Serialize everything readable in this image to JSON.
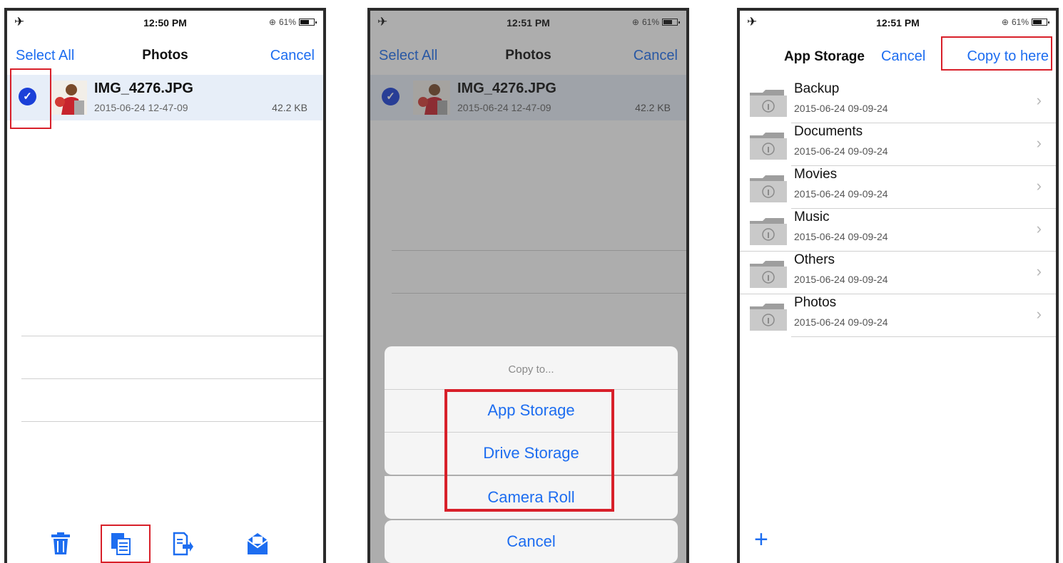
{
  "colors": {
    "accent": "#1d6df0",
    "highlight": "#d8202a",
    "selected_row": "#e7eef8"
  },
  "screen1": {
    "status": {
      "time": "12:50 PM",
      "battery": "61%"
    },
    "nav": {
      "left": "Select All",
      "title": "Photos",
      "right": "Cancel"
    },
    "file": {
      "name": "IMG_4276.JPG",
      "date": "2015-06-24 12-47-09",
      "size": "42.2 KB"
    },
    "toolbar_icons": [
      "trash-icon",
      "copy-icon",
      "export-icon",
      "mail-icon"
    ]
  },
  "screen2": {
    "status": {
      "time": "12:51 PM",
      "battery": "61%"
    },
    "nav": {
      "left": "Select All",
      "title": "Photos",
      "right": "Cancel"
    },
    "file": {
      "name": "IMG_4276.JPG",
      "date": "2015-06-24 12-47-09",
      "size": "42.2 KB"
    },
    "sheet": {
      "title": "Copy to...",
      "options": [
        "App Storage",
        "Drive Storage",
        "Camera Roll"
      ],
      "cancel": "Cancel"
    }
  },
  "screen3": {
    "status": {
      "time": "12:51 PM",
      "battery": "61%"
    },
    "nav": {
      "title": "App Storage",
      "cancel": "Cancel",
      "copy": "Copy to here"
    },
    "folders": [
      {
        "name": "Backup",
        "date": "2015-06-24 09-09-24"
      },
      {
        "name": "Documents",
        "date": "2015-06-24 09-09-24"
      },
      {
        "name": "Movies",
        "date": "2015-06-24 09-09-24"
      },
      {
        "name": "Music",
        "date": "2015-06-24 09-09-24"
      },
      {
        "name": "Others",
        "date": "2015-06-24 09-09-24"
      },
      {
        "name": "Photos",
        "date": "2015-06-24 09-09-24"
      }
    ],
    "add_label": "+"
  }
}
